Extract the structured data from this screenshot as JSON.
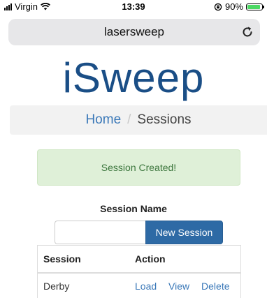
{
  "status_bar": {
    "carrier": "Virgin",
    "time": "13:39",
    "battery": "90%",
    "battery_level": 0.9
  },
  "browser": {
    "url": "lasersweep",
    "reload_icon": "reload-icon"
  },
  "logo": {
    "text": "iSweep"
  },
  "breadcrumb": {
    "home": "Home",
    "separator": "/",
    "current": "Sessions"
  },
  "alert": {
    "message": "Session Created!",
    "color": "#dff0d8"
  },
  "form": {
    "label": "Session Name",
    "input_value": "",
    "button_label": "New Session",
    "button_color": "#2e6aa5"
  },
  "table": {
    "headers": [
      "Session",
      "Action"
    ],
    "rows": [
      {
        "session": "Derby",
        "actions": [
          "Load",
          "View",
          "Delete"
        ]
      }
    ]
  }
}
